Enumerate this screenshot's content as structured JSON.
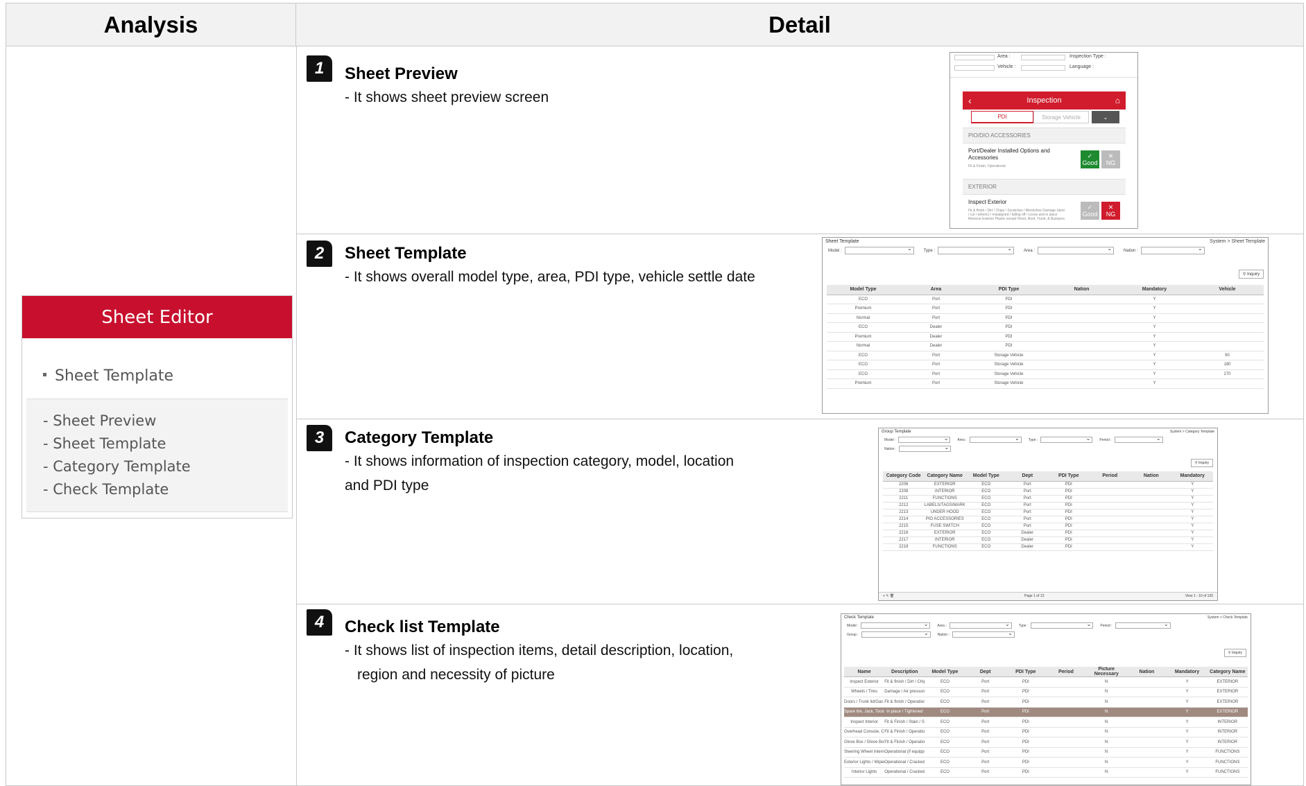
{
  "header": {
    "analysis": "Analysis",
    "detail": "Detail"
  },
  "sheet_editor": {
    "title": "Sheet Editor",
    "active_item": "Sheet Template",
    "items": [
      "- Sheet Preview",
      "- Sheet Template",
      "- Category Template",
      "- Check Template"
    ]
  },
  "rows": [
    {
      "num": "1",
      "title": "Sheet Preview",
      "desc": [
        "- It shows sheet preview screen"
      ]
    },
    {
      "num": "2",
      "title": "Sheet Template",
      "desc": [
        "- It shows overall model type, area, PDI type, vehicle settle date"
      ]
    },
    {
      "num": "3",
      "title": "Category Template",
      "desc": [
        "- It shows information of inspection category, model, location",
        "and PDI type"
      ]
    },
    {
      "num": "4",
      "title": "Check list Template",
      "desc": [
        "- It shows list of inspection items, detail description, location,",
        "region and necessity of picture"
      ]
    }
  ],
  "preview": {
    "filters": [
      "Area :",
      "Inspection Type :",
      "Vehicle :",
      "Language :"
    ],
    "header": "Inspection",
    "tabs": [
      "PDI",
      "Storage Vehicle"
    ],
    "sections": [
      {
        "name": "PIO/DIO ACCESSORIES",
        "item": "Port/Dealer Installed Options and Accessories",
        "sub": "Fit & Finish, Operational"
      },
      {
        "name": "EXTERIOR",
        "item": "Inspect Exterior",
        "sub": "Fit & finish / Dirt / Chips / Scratches / Blemishes Damage (dent / cut / etheric) / misaligned / falling off / Loose and in place Remove Exterior Plastic except Hood, Roof, Trunk, & Bumpers"
      }
    ],
    "good": "Good",
    "ng": "NG"
  },
  "sheet_template": {
    "title": "Sheet Template",
    "breadcrumb": "System > Sheet Template",
    "filters": [
      "Model :",
      "Type :",
      "Area :",
      "Nation :"
    ],
    "inquiry": "Inquiry",
    "columns": [
      "Model Type",
      "Area",
      "PDI Type",
      "Nation",
      "Mandatory",
      "Vehicle"
    ],
    "rows": [
      [
        "ECO",
        "Port",
        "PDI",
        "",
        "Y",
        ""
      ],
      [
        "Premium",
        "Port",
        "PDI",
        "",
        "Y",
        ""
      ],
      [
        "Normal",
        "Port",
        "PDI",
        "",
        "Y",
        ""
      ],
      [
        "ECO",
        "Dealer",
        "PDI",
        "",
        "Y",
        ""
      ],
      [
        "Premium",
        "Dealer",
        "PDI",
        "",
        "Y",
        ""
      ],
      [
        "Normal",
        "Dealer",
        "PDI",
        "",
        "Y",
        ""
      ],
      [
        "ECO",
        "Port",
        "Storage Vehicle",
        "",
        "Y",
        "90"
      ],
      [
        "ECO",
        "Port",
        "Storage Vehicle",
        "",
        "Y",
        "180"
      ],
      [
        "ECO",
        "Port",
        "Storage Vehicle",
        "",
        "Y",
        "270"
      ],
      [
        "Premium",
        "Port",
        "Storage Vehicle",
        "",
        "Y",
        ""
      ]
    ]
  },
  "category_template": {
    "title": "Group Template",
    "breadcrumb": "System > Category Template",
    "filters": [
      "Model :",
      "Area :",
      "Type :",
      "Period :",
      "Nation :"
    ],
    "inquiry": "Inquiry",
    "columns": [
      "Category Code",
      "Category Name",
      "Model Type",
      "Dept",
      "PDI Type",
      "Period",
      "Nation",
      "Mandatory"
    ],
    "rows": [
      [
        "2206",
        "EXTERIOR",
        "ECO",
        "Port",
        "PDI",
        "",
        "",
        "Y"
      ],
      [
        "2208",
        "INTERIOR",
        "ECO",
        "Port",
        "PDI",
        "",
        "",
        "Y"
      ],
      [
        "2211",
        "FUNCTIONS",
        "ECO",
        "Port",
        "PDI",
        "",
        "",
        "Y"
      ],
      [
        "2212",
        "LABELS/TAGS/MARKINGS",
        "ECO",
        "Port",
        "PDI",
        "",
        "",
        "Y"
      ],
      [
        "2213",
        "UNDER HOOD",
        "ECO",
        "Port",
        "PDI",
        "",
        "",
        "Y"
      ],
      [
        "2214",
        "PIO ACCESSORIES",
        "ECO",
        "Port",
        "PDI",
        "",
        "",
        "Y"
      ],
      [
        "2215",
        "FUSE SWITCH",
        "ECO",
        "Port",
        "PDI",
        "",
        "",
        "Y"
      ],
      [
        "2216",
        "EXTERIOR",
        "ECO",
        "Dealer",
        "PDI",
        "",
        "",
        "Y"
      ],
      [
        "2217",
        "INTERIOR",
        "ECO",
        "Dealer",
        "PDI",
        "",
        "",
        "Y"
      ],
      [
        "2218",
        "FUNCTIONS",
        "ECO",
        "Dealer",
        "PDI",
        "",
        "",
        "Y"
      ]
    ],
    "pager": "Page 1 of 13",
    "count": "View 1 - 10 of 130"
  },
  "check_template": {
    "title": "Check Template",
    "breadcrumb": "System > Check Template",
    "filters": [
      "Model :",
      "Area :",
      "Type :",
      "Period :",
      "Group :",
      "Nation :"
    ],
    "inquiry": "Inquiry",
    "columns": [
      "Name",
      "Description",
      "Model Type",
      "Dept",
      "PDI Type",
      "Period",
      "Picture Necessary",
      "Nation",
      "Mandatory",
      "Category Name"
    ],
    "rows": [
      [
        "Inspect Exterior",
        "Fit & finish / Dirt / Chips / misaligned / falling off / Remove all exterior covers",
        "ECO",
        "Port",
        "PDI",
        "",
        "N",
        "",
        "Y",
        "EXTERIOR"
      ],
      [
        "Wheels / Tires",
        "Damage / Air pressure",
        "ECO",
        "Port",
        "PDI",
        "",
        "N",
        "",
        "Y",
        "EXTERIOR"
      ],
      [
        "Doors / Trunk lid/Gas Tail",
        "Fit & finish / Operational",
        "ECO",
        "Port",
        "PDI",
        "",
        "N",
        "",
        "Y",
        "EXTERIOR"
      ],
      [
        "Spare tire, Jack, Tools",
        "In place / Tightened",
        "ECO",
        "Port",
        "PDI",
        "",
        "N",
        "",
        "Y",
        "EXTERIOR"
      ],
      [
        "Inspect Interior",
        "Fit & Finish / Stain / Scratches",
        "ECO",
        "Port",
        "PDI",
        "",
        "N",
        "",
        "Y",
        "INTERIOR"
      ],
      [
        "Overhead Console, Ctr C",
        "Fit & Finish / Operational",
        "ECO",
        "Port",
        "PDI",
        "",
        "N",
        "",
        "Y",
        "INTERIOR"
      ],
      [
        "Glove Box / Glove Box Lt",
        "Fit & Finish / Operational Check for Owner's Manual",
        "ECO",
        "Port",
        "PDI",
        "",
        "N",
        "",
        "Y",
        "INTERIOR"
      ],
      [
        "Steering Wheel Intern /",
        "Operational (if equipped)",
        "ECO",
        "Port",
        "PDI",
        "",
        "N",
        "",
        "Y",
        "FUNCTIONS"
      ],
      [
        "Exterior Lights / Wiper",
        "Operational / Cracked / Leak",
        "ECO",
        "Port",
        "PDI",
        "",
        "N",
        "",
        "Y",
        "FUNCTIONS"
      ],
      [
        "Interior Lights",
        "Operational / Cracked /",
        "ECO",
        "Port",
        "PDI",
        "",
        "N",
        "",
        "Y",
        "FUNCTIONS"
      ]
    ],
    "selected_row": 3
  }
}
